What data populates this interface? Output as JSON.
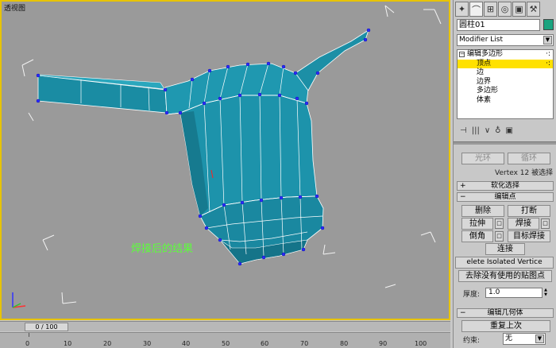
{
  "viewport": {
    "label": "透视图",
    "annotation": "焊接后的结果",
    "colors": {
      "background": "#9a9a9a",
      "border": "#e8c400",
      "mesh": "#1b8fa5",
      "edge": "#ffffff",
      "vertex": "#2b2bff",
      "annotation": "#5cff3a"
    }
  },
  "panel": {
    "tabs": [
      "create-icon",
      "modify-icon",
      "hierarchy-icon",
      "motion-icon",
      "display-icon",
      "utilities-icon"
    ],
    "object_name": "圆柱01",
    "object_color": "#1aa37f",
    "modifier_list": "Modifier List",
    "stack": [
      {
        "label": "编辑多边形",
        "pm": "−",
        "dots": "·:"
      },
      {
        "label": "顶点",
        "selected": true,
        "dots": "·:"
      },
      {
        "label": "边"
      },
      {
        "label": "边界"
      },
      {
        "label": "多边形"
      },
      {
        "label": "体素"
      }
    ],
    "stack_tools": [
      "⊣",
      "|||",
      "∨",
      "♁",
      "▣"
    ],
    "ring_label": "光环",
    "loop_label": "循环",
    "selection_info": "Vertex 12 被选择",
    "soft_selection": {
      "sign": "+",
      "title": "软化选择"
    },
    "edit_vertices": {
      "sign": "−",
      "title": "编辑点",
      "remove": "删除",
      "break": "打断",
      "extrude": "拉伸",
      "weld": "焊接",
      "chamfer": "倒角",
      "target_weld": "目标焊接",
      "connect": "连接",
      "remove_isolated": "elete Isolated Vertice",
      "remove_unused_map": "去除没有使用的贴图点",
      "weight_label": "厚度:",
      "weight_value": "1.0"
    },
    "edit_geometry": {
      "sign": "−",
      "title": "编辑几何体",
      "repeat_last": "重复上次",
      "constraint_label": "约束:",
      "constraint_value": "无"
    }
  },
  "timeline": {
    "frame_display": "0 / 100",
    "ticks": [
      "10",
      "20",
      "30",
      "40",
      "50",
      "60",
      "70",
      "80",
      "90",
      "100"
    ]
  }
}
